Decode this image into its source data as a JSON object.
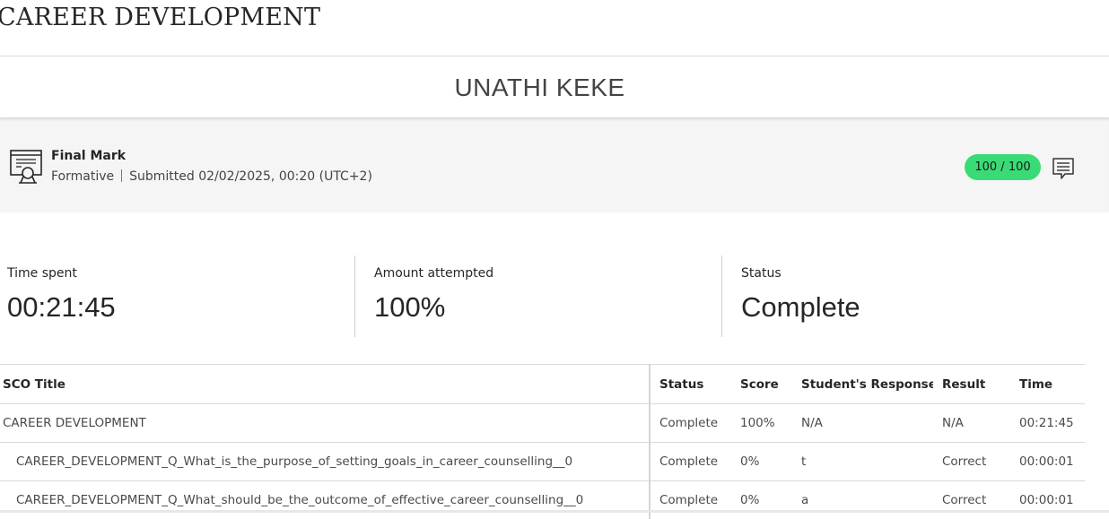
{
  "course": {
    "title": "CAREER DEVELOPMENT"
  },
  "student": {
    "name": "UNATHI KEKE"
  },
  "grade": {
    "title": "Final Mark",
    "type": "Formative",
    "submitted": "Submitted 02/02/2025, 00:20 (UTC+2)",
    "score": "100 / 100",
    "score_color": "#3adb76"
  },
  "stats": [
    {
      "label": "Time spent",
      "value": "00:21:45"
    },
    {
      "label": "Amount attempted",
      "value": "100%"
    },
    {
      "label": "Status",
      "value": "Complete"
    }
  ],
  "table": {
    "headers": [
      "SCO Title",
      "Status",
      "Score",
      "Student's Response",
      "Result",
      "Time"
    ],
    "rows": [
      [
        "CAREER DEVELOPMENT",
        "Complete",
        "100%",
        "N/A",
        "N/A",
        "00:21:45"
      ],
      [
        "CAREER_DEVELOPMENT_Q_What_is_the_purpose_of_setting_goals_in_career_counselling__0",
        "Complete",
        "0%",
        "t",
        "Correct",
        "00:00:01"
      ],
      [
        "CAREER_DEVELOPMENT_Q_What_should_be_the_outcome_of_effective_career_counselling__0",
        "Complete",
        "0%",
        "a",
        "Correct",
        "00:00:01"
      ]
    ]
  },
  "icons": {
    "grade": "certificate-icon",
    "feedback": "feedback-comment-icon"
  }
}
